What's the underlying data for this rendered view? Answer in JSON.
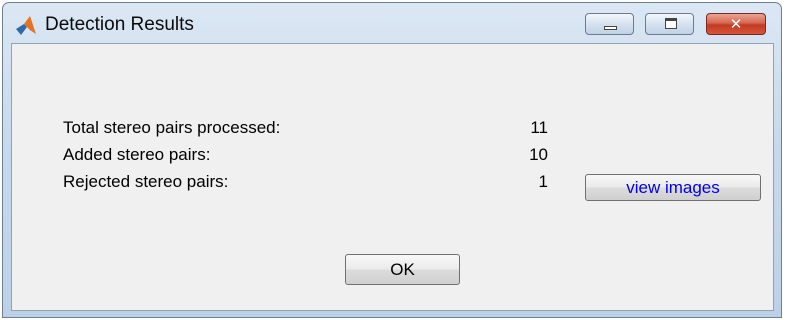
{
  "window": {
    "title": "Detection Results"
  },
  "stats": [
    {
      "label": "Total stereo pairs processed:",
      "value": "11"
    },
    {
      "label": "Added stereo pairs:",
      "value": "10"
    },
    {
      "label": "Rejected stereo pairs:",
      "value": "1"
    }
  ],
  "buttons": {
    "view_images": "view images",
    "ok": "OK"
  },
  "icons": {
    "app": "matlab-logo-icon",
    "minimize": "minimize-icon",
    "maximize": "maximize-icon",
    "close": "close-icon"
  },
  "colors": {
    "link_text": "#0000e8",
    "close_button": "#c23a22",
    "client_background": "#f0f0f0"
  }
}
